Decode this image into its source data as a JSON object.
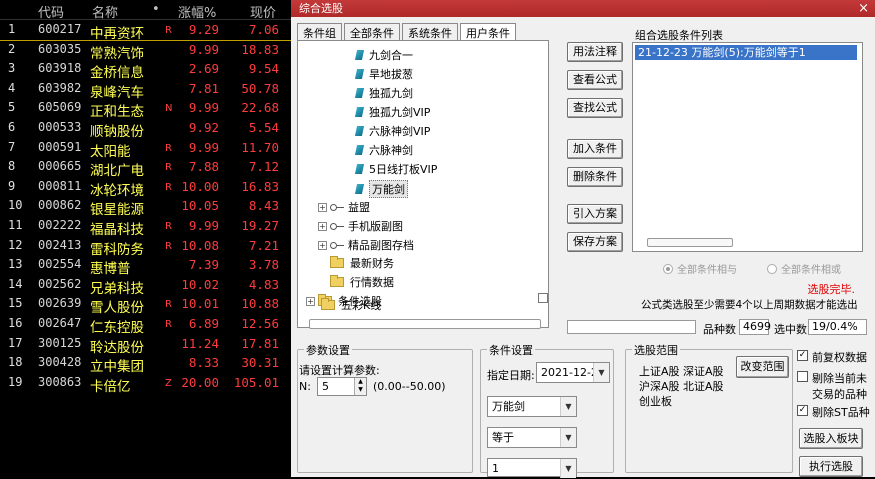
{
  "stock_list": {
    "headers": {
      "code": "代码",
      "name": "名称",
      "dot": "•",
      "change": "涨幅%",
      "price": "现价"
    },
    "rows": [
      {
        "idx": "1",
        "code": "600217",
        "name": "中再资环",
        "flag": "R",
        "change": "9.29",
        "price": "7.06"
      },
      {
        "idx": "2",
        "code": "603035",
        "name": "常熟汽饰",
        "flag": "",
        "change": "9.99",
        "price": "18.83"
      },
      {
        "idx": "3",
        "code": "603918",
        "name": "金桥信息",
        "flag": "",
        "change": "2.69",
        "price": "9.54"
      },
      {
        "idx": "4",
        "code": "603982",
        "name": "泉峰汽车",
        "flag": "",
        "change": "7.81",
        "price": "50.78"
      },
      {
        "idx": "5",
        "code": "605069",
        "name": "正和生态",
        "flag": "N",
        "change": "9.99",
        "price": "22.68"
      },
      {
        "idx": "6",
        "code": "000533",
        "name": "顺钠股份",
        "flag": "",
        "change": "9.92",
        "price": "5.54"
      },
      {
        "idx": "7",
        "code": "000591",
        "name": "太阳能",
        "flag": "R",
        "change": "9.99",
        "price": "11.70"
      },
      {
        "idx": "8",
        "code": "000665",
        "name": "湖北广电",
        "flag": "R",
        "change": "7.88",
        "price": "7.12"
      },
      {
        "idx": "9",
        "code": "000811",
        "name": "冰轮环境",
        "flag": "R",
        "change": "10.00",
        "price": "16.83"
      },
      {
        "idx": "10",
        "code": "000862",
        "name": "银星能源",
        "flag": "",
        "change": "10.05",
        "price": "8.43"
      },
      {
        "idx": "11",
        "code": "002222",
        "name": "福晶科技",
        "flag": "R",
        "change": "9.99",
        "price": "19.27"
      },
      {
        "idx": "12",
        "code": "002413",
        "name": "雷科防务",
        "flag": "R",
        "change": "10.08",
        "price": "7.21"
      },
      {
        "idx": "13",
        "code": "002554",
        "name": "惠博普",
        "flag": "",
        "change": "7.39",
        "price": "3.78"
      },
      {
        "idx": "14",
        "code": "002562",
        "name": "兄弟科技",
        "flag": "",
        "change": "10.02",
        "price": "4.83"
      },
      {
        "idx": "15",
        "code": "002639",
        "name": "雪人股份",
        "flag": "R",
        "change": "10.01",
        "price": "10.88"
      },
      {
        "idx": "16",
        "code": "002647",
        "name": "仁东控股",
        "flag": "R",
        "change": "6.89",
        "price": "12.56"
      },
      {
        "idx": "17",
        "code": "300125",
        "name": "聆达股份",
        "flag": "",
        "change": "11.24",
        "price": "17.81"
      },
      {
        "idx": "18",
        "code": "300428",
        "name": "立中集团",
        "flag": "",
        "change": "8.33",
        "price": "30.31"
      },
      {
        "idx": "19",
        "code": "300863",
        "name": "卡倍亿",
        "flag": "Z",
        "change": "20.00",
        "price": "105.01"
      }
    ]
  },
  "dialog": {
    "title": "综合选股",
    "close": "×",
    "tabs": [
      "条件组",
      "全部条件",
      "系统条件",
      "用户条件"
    ],
    "tree": {
      "leaves": [
        "九剑合一",
        "旱地拔葱",
        "独孤九剑",
        "独孤九剑VIP",
        "六脉神剑VIP",
        "六脉神剑",
        "5日线打板VIP",
        "万能剑"
      ],
      "keys": [
        "益盟",
        "手机版副图",
        "精品副图存档"
      ],
      "folders": [
        "最新财务",
        "行情数据",
        "条件选股",
        "五彩K线"
      ],
      "expand": "+"
    },
    "buttons": {
      "usage": "用法注释",
      "view_formula": "查看公式",
      "find_formula": "查找公式",
      "add_condition": "加入条件",
      "delete_condition": "删除条件",
      "import_plan": "引入方案",
      "save_plan": "保存方案",
      "change_range": "改变范围",
      "add_to_block": "选股入板块",
      "run": "执行选股"
    },
    "combo": {
      "label": "组合选股条件列表",
      "items": [
        "21-12-23 万能剑(5):万能剑等于1"
      ]
    },
    "radios": {
      "all_and": "全部条件相与",
      "all_or": "全部条件相或"
    },
    "status": "选股完毕.",
    "note": "公式类选股至少需要4个以上周期数据才能选出",
    "counts": {
      "total_label": "品种数",
      "total_value": "4699",
      "selected_label": "选中数",
      "selected_value": "19/0.4%"
    },
    "params": {
      "title": "参数设置",
      "prompt": "请设置计算参数:",
      "n_label": "N:",
      "n_value": "5",
      "range": "(0.00--50.00)"
    },
    "condition": {
      "title": "条件设置",
      "date_label": "指定日期:",
      "date_value": "2021-12-23",
      "formula": "万能剑",
      "operator": "等于",
      "value": "1"
    },
    "range_group": {
      "title": "选股范围",
      "line1": "上证A股 深证A股",
      "line2": "沪深A股 北证A股",
      "line3": "创业板"
    },
    "checkboxes": {
      "pre_adjust": "前复权数据",
      "exclude_suspend_1": "剔除当前未",
      "exclude_suspend_2": "交易的品种",
      "exclude_st": "剔除ST品种",
      "check_mark": "✓"
    }
  }
}
